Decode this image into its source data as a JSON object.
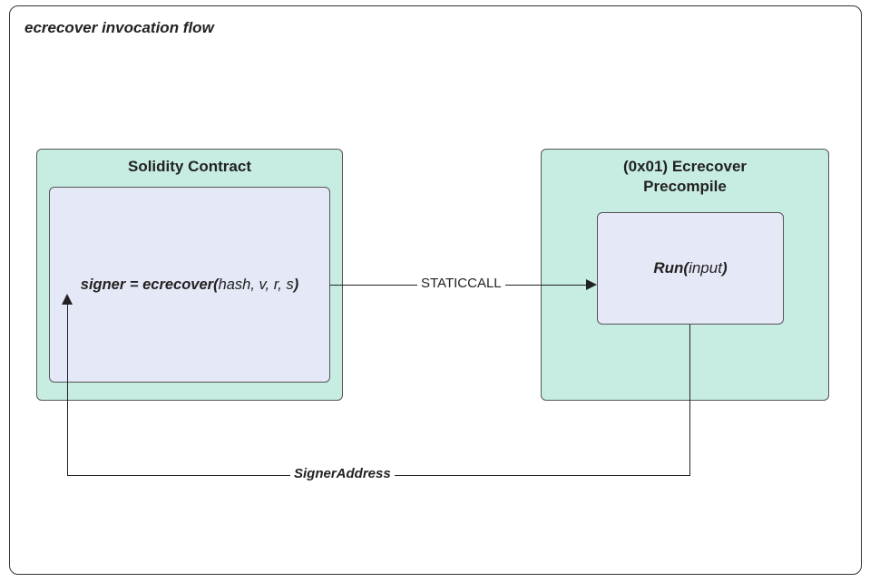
{
  "title": "ecrecover invocation flow",
  "left_box": {
    "title": "Solidity Contract",
    "code": {
      "assign": "signer = ecrecover(",
      "args": "hash, v, r, s",
      "close": ")"
    }
  },
  "right_box": {
    "title_line1": "(0x01) Ecrecover",
    "title_line2": "Precompile",
    "run": {
      "name": "Run(",
      "arg": "input",
      "close": ")"
    }
  },
  "edges": {
    "call": "STATICCALL",
    "return": "SignerAddress"
  }
}
